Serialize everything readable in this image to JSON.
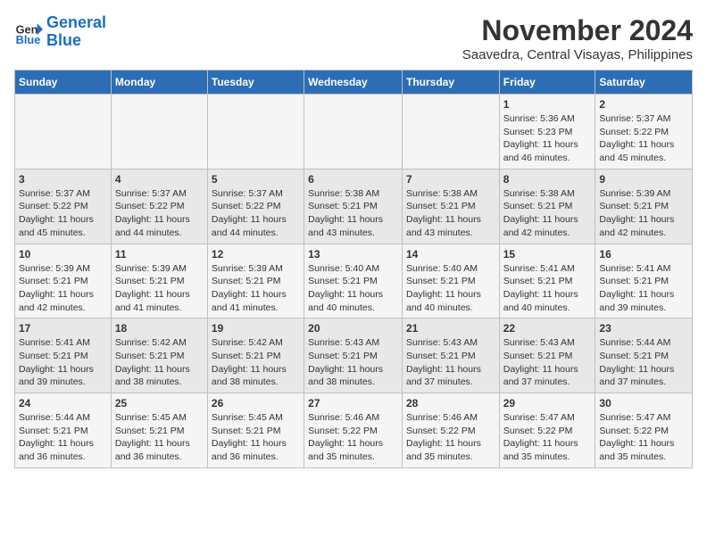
{
  "logo": {
    "text_general": "General",
    "text_blue": "Blue"
  },
  "title": {
    "month_year": "November 2024",
    "location": "Saavedra, Central Visayas, Philippines"
  },
  "headers": [
    "Sunday",
    "Monday",
    "Tuesday",
    "Wednesday",
    "Thursday",
    "Friday",
    "Saturday"
  ],
  "weeks": [
    [
      {
        "day": "",
        "info": ""
      },
      {
        "day": "",
        "info": ""
      },
      {
        "day": "",
        "info": ""
      },
      {
        "day": "",
        "info": ""
      },
      {
        "day": "",
        "info": ""
      },
      {
        "day": "1",
        "info": "Sunrise: 5:36 AM\nSunset: 5:23 PM\nDaylight: 11 hours and 46 minutes."
      },
      {
        "day": "2",
        "info": "Sunrise: 5:37 AM\nSunset: 5:22 PM\nDaylight: 11 hours and 45 minutes."
      }
    ],
    [
      {
        "day": "3",
        "info": "Sunrise: 5:37 AM\nSunset: 5:22 PM\nDaylight: 11 hours and 45 minutes."
      },
      {
        "day": "4",
        "info": "Sunrise: 5:37 AM\nSunset: 5:22 PM\nDaylight: 11 hours and 44 minutes."
      },
      {
        "day": "5",
        "info": "Sunrise: 5:37 AM\nSunset: 5:22 PM\nDaylight: 11 hours and 44 minutes."
      },
      {
        "day": "6",
        "info": "Sunrise: 5:38 AM\nSunset: 5:21 PM\nDaylight: 11 hours and 43 minutes."
      },
      {
        "day": "7",
        "info": "Sunrise: 5:38 AM\nSunset: 5:21 PM\nDaylight: 11 hours and 43 minutes."
      },
      {
        "day": "8",
        "info": "Sunrise: 5:38 AM\nSunset: 5:21 PM\nDaylight: 11 hours and 42 minutes."
      },
      {
        "day": "9",
        "info": "Sunrise: 5:39 AM\nSunset: 5:21 PM\nDaylight: 11 hours and 42 minutes."
      }
    ],
    [
      {
        "day": "10",
        "info": "Sunrise: 5:39 AM\nSunset: 5:21 PM\nDaylight: 11 hours and 42 minutes."
      },
      {
        "day": "11",
        "info": "Sunrise: 5:39 AM\nSunset: 5:21 PM\nDaylight: 11 hours and 41 minutes."
      },
      {
        "day": "12",
        "info": "Sunrise: 5:39 AM\nSunset: 5:21 PM\nDaylight: 11 hours and 41 minutes."
      },
      {
        "day": "13",
        "info": "Sunrise: 5:40 AM\nSunset: 5:21 PM\nDaylight: 11 hours and 40 minutes."
      },
      {
        "day": "14",
        "info": "Sunrise: 5:40 AM\nSunset: 5:21 PM\nDaylight: 11 hours and 40 minutes."
      },
      {
        "day": "15",
        "info": "Sunrise: 5:41 AM\nSunset: 5:21 PM\nDaylight: 11 hours and 40 minutes."
      },
      {
        "day": "16",
        "info": "Sunrise: 5:41 AM\nSunset: 5:21 PM\nDaylight: 11 hours and 39 minutes."
      }
    ],
    [
      {
        "day": "17",
        "info": "Sunrise: 5:41 AM\nSunset: 5:21 PM\nDaylight: 11 hours and 39 minutes."
      },
      {
        "day": "18",
        "info": "Sunrise: 5:42 AM\nSunset: 5:21 PM\nDaylight: 11 hours and 38 minutes."
      },
      {
        "day": "19",
        "info": "Sunrise: 5:42 AM\nSunset: 5:21 PM\nDaylight: 11 hours and 38 minutes."
      },
      {
        "day": "20",
        "info": "Sunrise: 5:43 AM\nSunset: 5:21 PM\nDaylight: 11 hours and 38 minutes."
      },
      {
        "day": "21",
        "info": "Sunrise: 5:43 AM\nSunset: 5:21 PM\nDaylight: 11 hours and 37 minutes."
      },
      {
        "day": "22",
        "info": "Sunrise: 5:43 AM\nSunset: 5:21 PM\nDaylight: 11 hours and 37 minutes."
      },
      {
        "day": "23",
        "info": "Sunrise: 5:44 AM\nSunset: 5:21 PM\nDaylight: 11 hours and 37 minutes."
      }
    ],
    [
      {
        "day": "24",
        "info": "Sunrise: 5:44 AM\nSunset: 5:21 PM\nDaylight: 11 hours and 36 minutes."
      },
      {
        "day": "25",
        "info": "Sunrise: 5:45 AM\nSunset: 5:21 PM\nDaylight: 11 hours and 36 minutes."
      },
      {
        "day": "26",
        "info": "Sunrise: 5:45 AM\nSunset: 5:21 PM\nDaylight: 11 hours and 36 minutes."
      },
      {
        "day": "27",
        "info": "Sunrise: 5:46 AM\nSunset: 5:22 PM\nDaylight: 11 hours and 35 minutes."
      },
      {
        "day": "28",
        "info": "Sunrise: 5:46 AM\nSunset: 5:22 PM\nDaylight: 11 hours and 35 minutes."
      },
      {
        "day": "29",
        "info": "Sunrise: 5:47 AM\nSunset: 5:22 PM\nDaylight: 11 hours and 35 minutes."
      },
      {
        "day": "30",
        "info": "Sunrise: 5:47 AM\nSunset: 5:22 PM\nDaylight: 11 hours and 35 minutes."
      }
    ]
  ]
}
